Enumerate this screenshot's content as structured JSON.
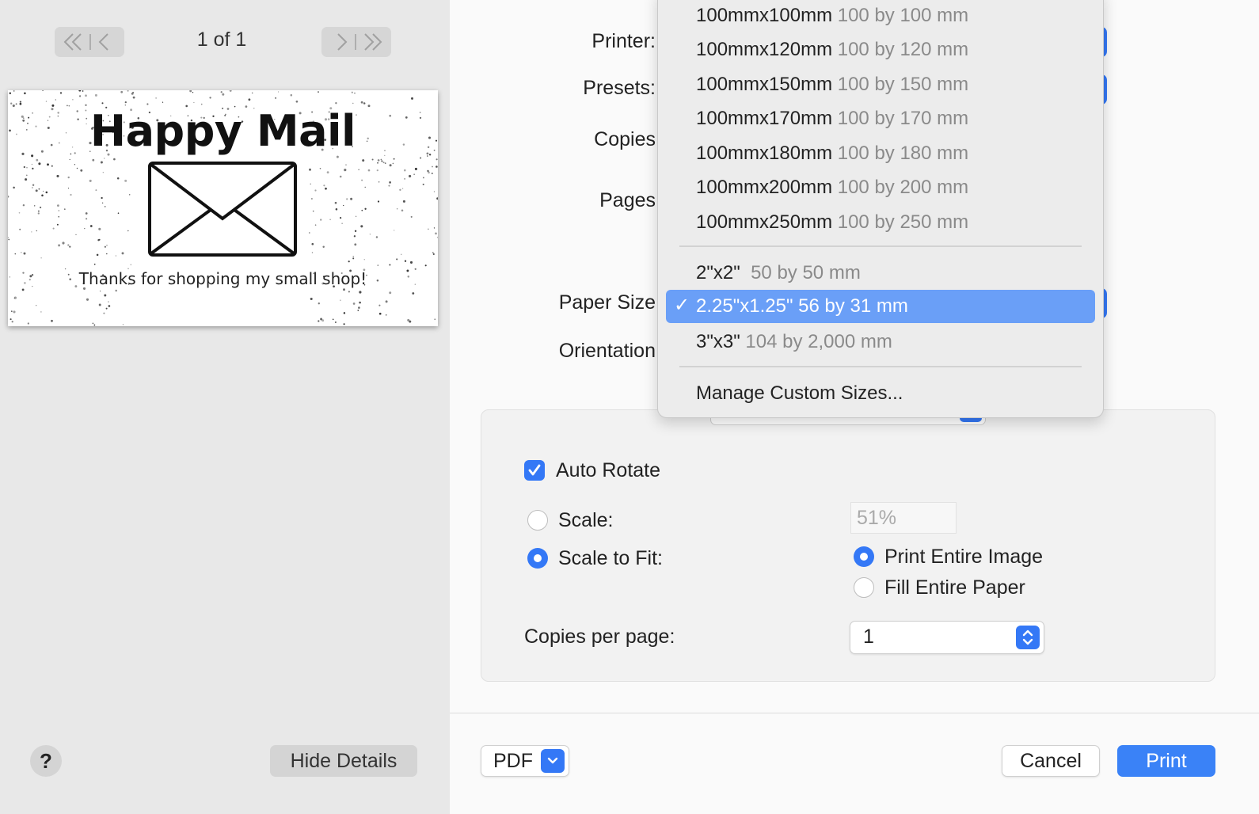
{
  "preview": {
    "page_count": "1 of 1",
    "image_title": "Happy Mail",
    "image_subtitle": "Thanks for shopping my small shop!"
  },
  "left_footer": {
    "help_label": "?",
    "hide_details_label": "Hide Details"
  },
  "labels": {
    "printer": "Printer:",
    "presets": "Presets:",
    "copies": "Copies",
    "pages": "Pages",
    "paper_size": "Paper Size",
    "orientation": "Orientation"
  },
  "paper_menu": {
    "items": [
      {
        "name": "100mmx100mm",
        "size": "100 by 100 mm"
      },
      {
        "name": "100mmx120mm",
        "size": "100 by 120 mm"
      },
      {
        "name": "100mmx150mm",
        "size": "100 by 150 mm"
      },
      {
        "name": "100mmx170mm",
        "size": "100 by 170 mm"
      },
      {
        "name": "100mmx180mm",
        "size": "100 by 180 mm"
      },
      {
        "name": "100mmx200mm",
        "size": "100 by 200 mm"
      },
      {
        "name": "100mmx250mm",
        "size": "100 by 250 mm"
      }
    ],
    "custom_items": [
      {
        "name": "2\"x2\"",
        "size": "50 by 50 mm"
      },
      {
        "name": "2.25\"x1.25\"",
        "size": "56 by 31 mm",
        "selected": true
      },
      {
        "name": "3\"x3\"",
        "size": "104 by 2,000 mm"
      }
    ],
    "manage_label": "Manage Custom Sizes..."
  },
  "options": {
    "auto_rotate_label": "Auto Rotate",
    "auto_rotate_checked": true,
    "scale_label": "Scale:",
    "scale_value": "51%",
    "scale_to_fit_label": "Scale to Fit:",
    "scale_to_fit_selected": true,
    "print_entire_image_label": "Print Entire Image",
    "fill_entire_paper_label": "Fill Entire Paper",
    "copies_per_page_label": "Copies per page:",
    "copies_per_page_value": "1"
  },
  "footer": {
    "pdf_label": "PDF",
    "cancel_label": "Cancel",
    "print_label": "Print"
  },
  "colors": {
    "accent": "#3478f6",
    "menu_highlight": "#6a9ff7"
  }
}
